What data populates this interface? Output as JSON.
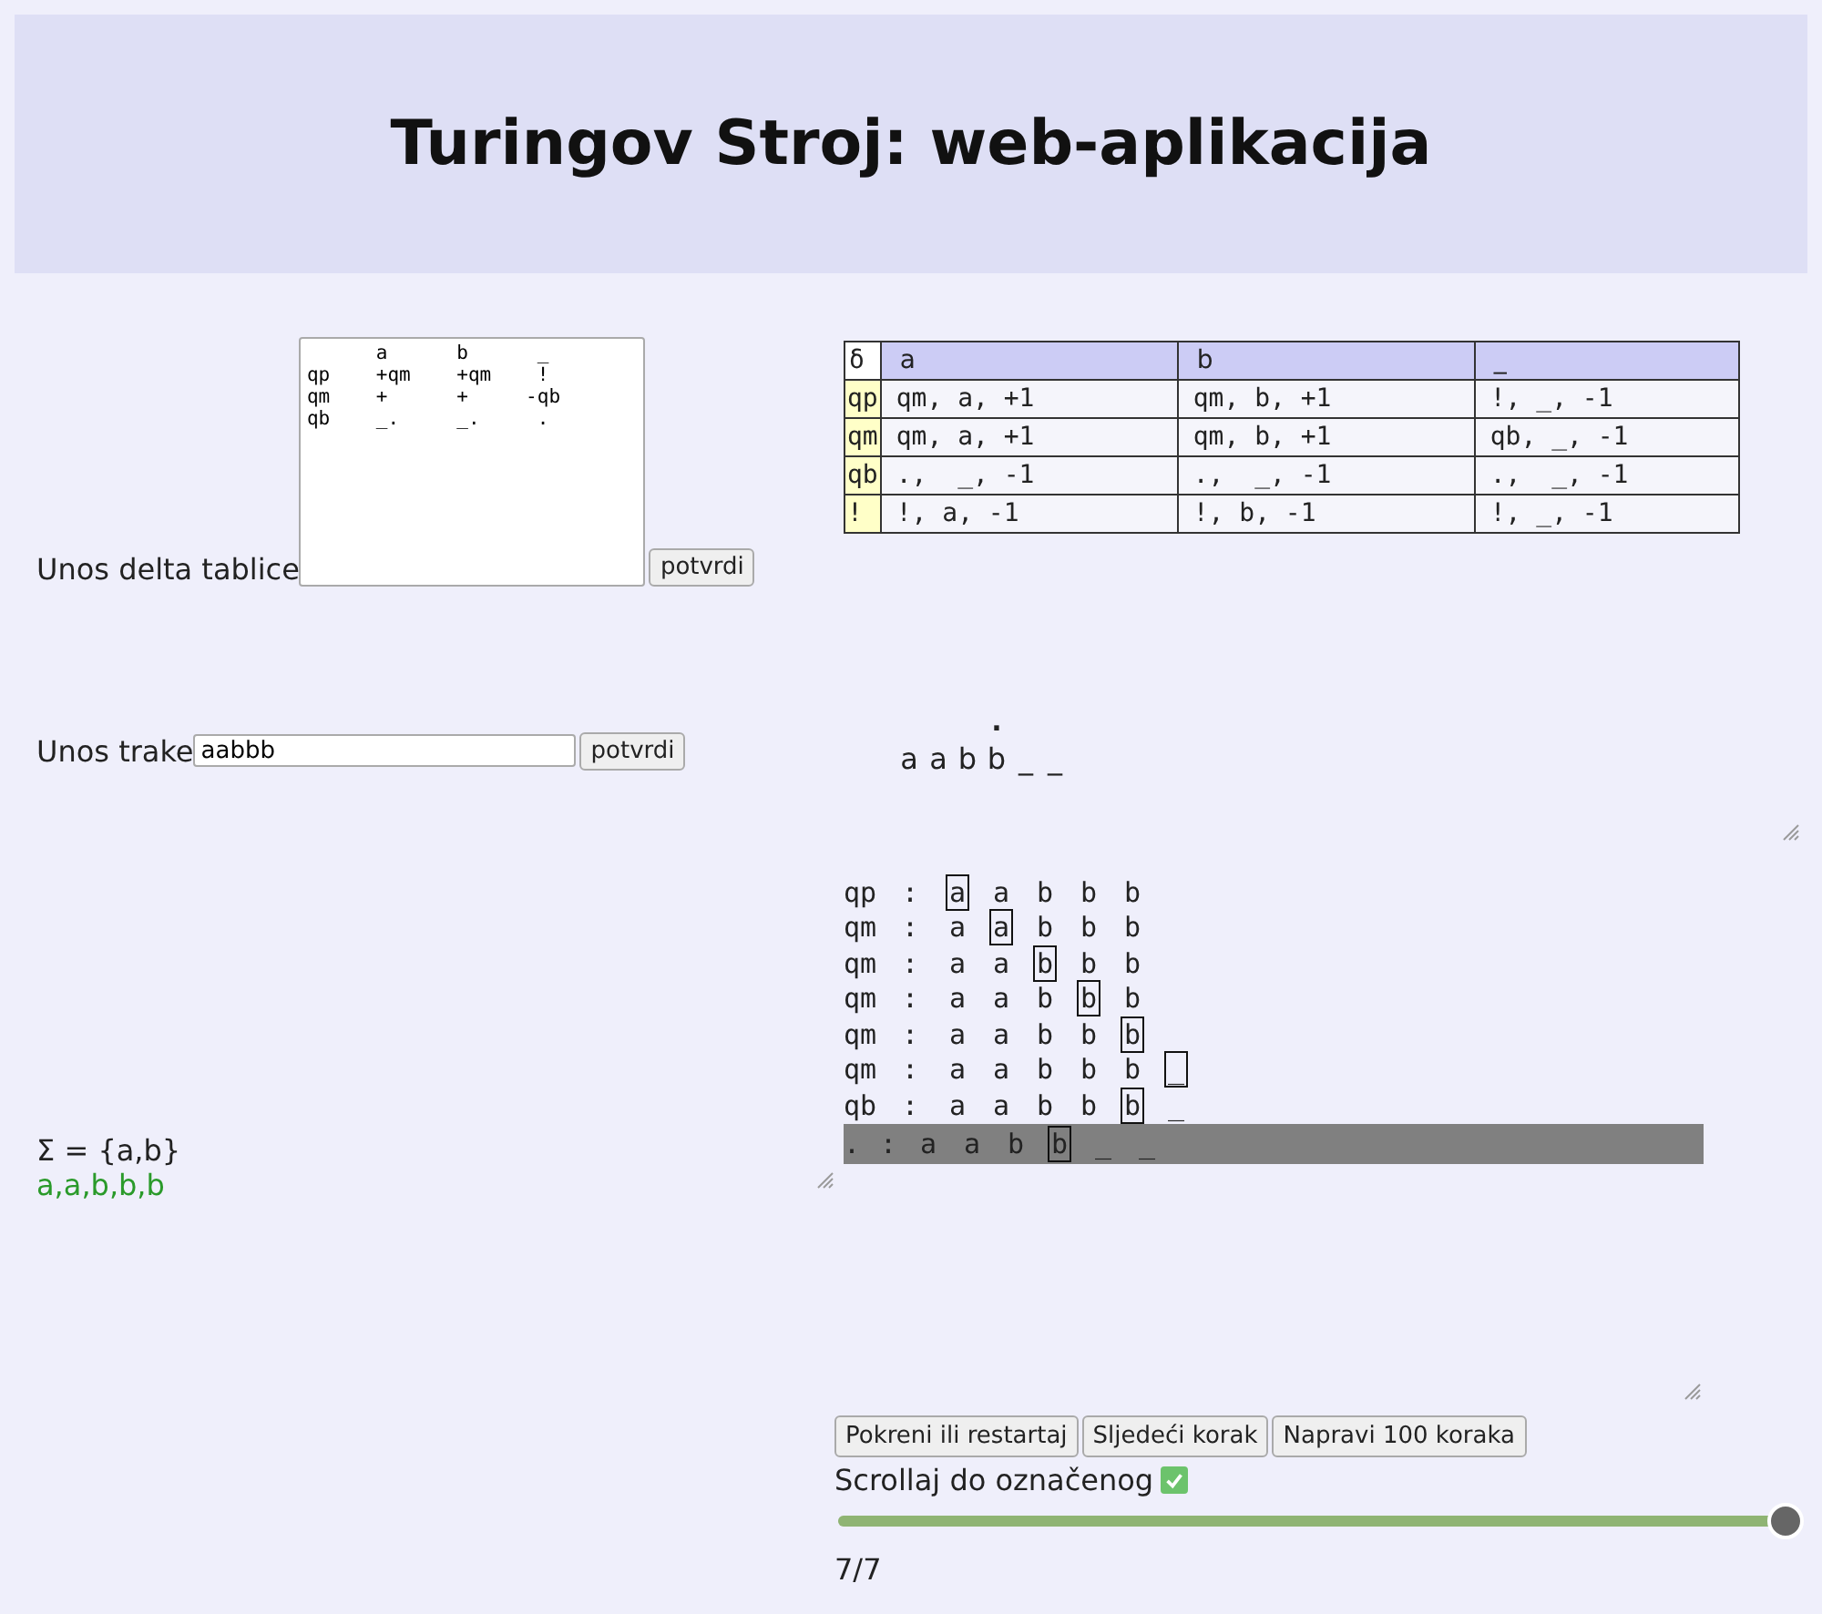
{
  "header": {
    "title": "Turingov Stroj: web-aplikacija"
  },
  "delta_input": {
    "label": "Unos delta tablice",
    "value": "      a      b      _\nqp    +qm    +qm    !\nqm    +      +     -qb\nqb    _.     _.     .",
    "button": "potvrdi"
  },
  "delta_table": {
    "corner": "δ",
    "columns": [
      "a",
      "b",
      "_"
    ],
    "rows": [
      {
        "state": "qp",
        "cells": [
          "qm, a, +1",
          "qm, b, +1",
          "!, _, -1"
        ]
      },
      {
        "state": "qm",
        "cells": [
          "qm, a, +1",
          "qm, b, +1",
          "qb, _, -1"
        ]
      },
      {
        "state": "qb",
        "cells": [
          ".,  _, -1",
          ".,  _, -1",
          ".,  _, -1"
        ]
      },
      {
        "state": "!",
        "cells": [
          "!, a, -1",
          "!, b, -1",
          "!, _, -1"
        ]
      }
    ]
  },
  "tape_input": {
    "label": "Unos trake",
    "value": "aabbb",
    "button": "potvrdi"
  },
  "tape": {
    "state": ".",
    "cells": [
      {
        "symbol": "a",
        "head": false
      },
      {
        "symbol": "a",
        "head": false
      },
      {
        "symbol": "b",
        "head": false
      },
      {
        "symbol": "b",
        "head": true
      },
      {
        "symbol": "_",
        "head": false
      },
      {
        "symbol": "_",
        "head": false
      }
    ]
  },
  "alphabet": {
    "definition": "Σ = {a,b}",
    "word": "a,a,b,b,b"
  },
  "trace": [
    {
      "state": "qp",
      "separator": ":",
      "selected": false,
      "cells": [
        {
          "symbol": "a",
          "head": true
        },
        {
          "symbol": "a",
          "head": false
        },
        {
          "symbol": "b",
          "head": false
        },
        {
          "symbol": "b",
          "head": false
        },
        {
          "symbol": "b",
          "head": false
        }
      ]
    },
    {
      "state": "qm",
      "separator": ":",
      "selected": false,
      "cells": [
        {
          "symbol": "a",
          "head": false
        },
        {
          "symbol": "a",
          "head": true
        },
        {
          "symbol": "b",
          "head": false
        },
        {
          "symbol": "b",
          "head": false
        },
        {
          "symbol": "b",
          "head": false
        }
      ]
    },
    {
      "state": "qm",
      "separator": ":",
      "selected": false,
      "cells": [
        {
          "symbol": "a",
          "head": false
        },
        {
          "symbol": "a",
          "head": false
        },
        {
          "symbol": "b",
          "head": true
        },
        {
          "symbol": "b",
          "head": false
        },
        {
          "symbol": "b",
          "head": false
        }
      ]
    },
    {
      "state": "qm",
      "separator": ":",
      "selected": false,
      "cells": [
        {
          "symbol": "a",
          "head": false
        },
        {
          "symbol": "a",
          "head": false
        },
        {
          "symbol": "b",
          "head": false
        },
        {
          "symbol": "b",
          "head": true
        },
        {
          "symbol": "b",
          "head": false
        }
      ]
    },
    {
      "state": "qm",
      "separator": ":",
      "selected": false,
      "cells": [
        {
          "symbol": "a",
          "head": false
        },
        {
          "symbol": "a",
          "head": false
        },
        {
          "symbol": "b",
          "head": false
        },
        {
          "symbol": "b",
          "head": false
        },
        {
          "symbol": "b",
          "head": true
        }
      ]
    },
    {
      "state": "qm",
      "separator": ":",
      "selected": false,
      "cells": [
        {
          "symbol": "a",
          "head": false
        },
        {
          "symbol": "a",
          "head": false
        },
        {
          "symbol": "b",
          "head": false
        },
        {
          "symbol": "b",
          "head": false
        },
        {
          "symbol": "b",
          "head": false
        },
        {
          "symbol": "_",
          "head": true
        }
      ]
    },
    {
      "state": "qb",
      "separator": ":",
      "selected": false,
      "cells": [
        {
          "symbol": "a",
          "head": false
        },
        {
          "symbol": "a",
          "head": false
        },
        {
          "symbol": "b",
          "head": false
        },
        {
          "symbol": "b",
          "head": false
        },
        {
          "symbol": "b",
          "head": true
        },
        {
          "symbol": "_",
          "head": false
        }
      ]
    },
    {
      "state": ".",
      "separator": ":",
      "selected": true,
      "cells": [
        {
          "symbol": "a",
          "head": false
        },
        {
          "symbol": "a",
          "head": false
        },
        {
          "symbol": "b",
          "head": false
        },
        {
          "symbol": "b",
          "head": true
        },
        {
          "symbol": "_",
          "head": false
        },
        {
          "symbol": "_",
          "head": false
        }
      ]
    }
  ],
  "controls": {
    "buttons": [
      "Pokreni ili restartaj",
      "Sljedeći korak",
      "Napravi 100 koraka"
    ],
    "scroll_option": {
      "label": "Scrollaj do označenog",
      "checked": true
    },
    "step_slider": {
      "level": 1
    },
    "step_counter": "7/7"
  }
}
